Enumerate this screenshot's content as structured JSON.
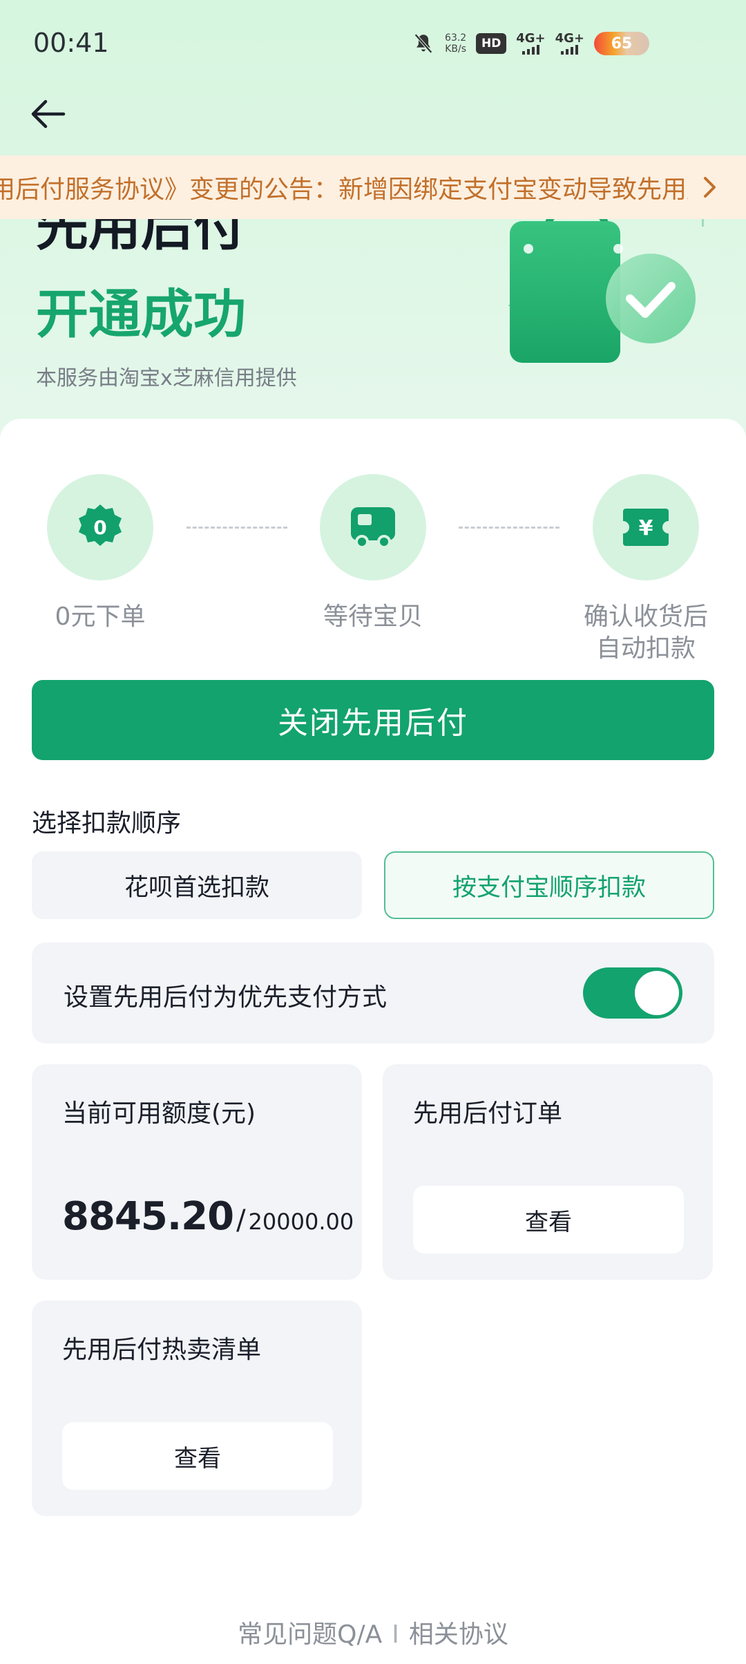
{
  "status_bar": {
    "time": "00:41",
    "speed_value": "63.2",
    "speed_unit": "KB/s",
    "hd": "HD",
    "net1": "4G+",
    "net2": "4G+",
    "battery": "65"
  },
  "notice": {
    "text": "用后付服务协议》变更的公告：新增因绑定支付宝变动导致先用后付"
  },
  "hero": {
    "title": "先用后付",
    "status": "开通成功",
    "subtitle": "本服务由淘宝x芝麻信用提供"
  },
  "steps": [
    {
      "icon_text": "0",
      "label": "0元下单"
    },
    {
      "label": "等待宝贝"
    },
    {
      "icon_text": "¥",
      "label": "确认收货后自动扣款"
    }
  ],
  "primary_button": "关闭先用后付",
  "deduction": {
    "title": "选择扣款顺序",
    "options": [
      {
        "label": "花呗首选扣款",
        "selected": false
      },
      {
        "label": "按支付宝顺序扣款",
        "selected": true
      }
    ]
  },
  "priority": {
    "label": "设置先用后付为优先支付方式",
    "enabled": true
  },
  "quota": {
    "title": "当前可用额度(元)",
    "available": "8845.20",
    "separator": "/",
    "total": "20000.00"
  },
  "orders": {
    "title": "先用后付订单",
    "button": "查看"
  },
  "hot_list": {
    "title": "先用后付热卖清单",
    "button": "查看"
  },
  "footer": {
    "faq": "常见问题Q/A",
    "separator": "I",
    "agreements": "相关协议"
  },
  "colors": {
    "accent": "#13a36e",
    "hero_bg": "#d6f6df",
    "notice_bg": "#fdf0e1",
    "notice_text": "#c2702b"
  }
}
